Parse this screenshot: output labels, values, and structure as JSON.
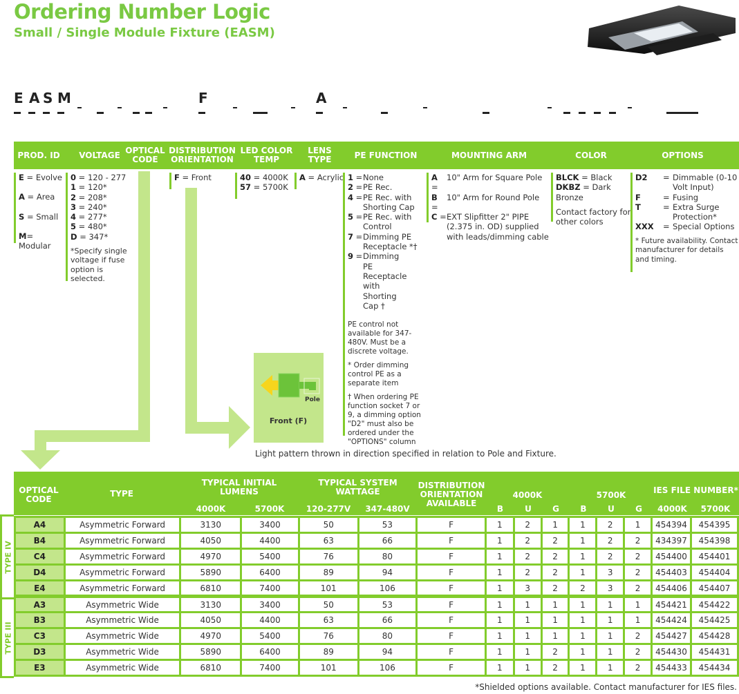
{
  "header": {
    "title": "Ordering Number Logic",
    "subtitle": "Small / Single Module Fixture (EASM)"
  },
  "code_template": {
    "chars": [
      "E",
      "A",
      "S",
      "M",
      "F",
      "A"
    ]
  },
  "columns": {
    "prod_id": {
      "label": "PROD. ID",
      "items": [
        {
          "code": "E",
          "sep": " = ",
          "text": "Evolve"
        },
        {
          "code": "A",
          "sep": " = ",
          "text": "Area"
        },
        {
          "code": "S",
          "sep": " = ",
          "text": "Small"
        },
        {
          "code": "M",
          "sep": "= ",
          "text": "Modular"
        }
      ]
    },
    "voltage": {
      "label": "VOLTAGE",
      "items": [
        {
          "code": "0",
          "text": " = 120 - 277"
        },
        {
          "code": "1",
          "text": " = 120*"
        },
        {
          "code": "2",
          "text": " = 208*"
        },
        {
          "code": "3",
          "text": " = 240*"
        },
        {
          "code": "4",
          "text": " = 277*"
        },
        {
          "code": "5",
          "text": " = 480*"
        },
        {
          "code": "D",
          "text": " = 347*"
        }
      ],
      "note": "*Specify single voltage if fuse option is selected."
    },
    "optical_code": {
      "label": "OPTICAL CODE"
    },
    "distribution": {
      "label": "DISTRIBUTION ORIENTATION",
      "items": [
        {
          "code": "F",
          "text": " = Front"
        }
      ]
    },
    "led_color": {
      "label": "LED COLOR TEMP",
      "items": [
        {
          "code": "40",
          "text": " = 4000K"
        },
        {
          "code": "57",
          "text": " = 5700K"
        }
      ]
    },
    "lens": {
      "label": "LENS TYPE",
      "items": [
        {
          "code": "A",
          "text": " = Acrylic"
        }
      ]
    },
    "pe_function": {
      "label": "PE FUNCTION",
      "items": [
        {
          "code": "1",
          "text": "None"
        },
        {
          "code": "2",
          "text": "PE Rec."
        },
        {
          "code": "4",
          "text": "PE Rec. with Shorting Cap"
        },
        {
          "code": "5",
          "text": "PE Rec. with Control"
        },
        {
          "code": "7",
          "text": "Dimming PE Receptacle *†"
        },
        {
          "code": "9",
          "text": "Dimming PE Receptacle with Shorting Cap †"
        }
      ],
      "notes": [
        "PE control not available for 347-480V. Must be a discrete voltage.",
        "* Order dimming control PE as a separate item",
        "† When ordering PE function socket 7 or 9, a dimming option \"D2\" must also be ordered under the \"OPTIONS\" column"
      ]
    },
    "mounting_arm": {
      "label": "MOUNTING ARM",
      "items": [
        {
          "code": "A",
          "text": "10\" Arm for Square Pole"
        },
        {
          "code": "B",
          "text": "10\" Arm for Round Pole"
        },
        {
          "code": "C",
          "text": "EXT Slipfitter 2\" PIPE (2.375 in. OD) supplied with leads/dimming cable"
        }
      ]
    },
    "color": {
      "label": "COLOR",
      "items": [
        {
          "code": "BLCK",
          "text": " = Black"
        },
        {
          "code": "DKBZ",
          "text": " = Dark Bronze"
        }
      ],
      "note": "Contact factory for other colors"
    },
    "options": {
      "label": "OPTIONS",
      "items": [
        {
          "code": "D2",
          "text": "Dimmable (0-10 Volt Input)"
        },
        {
          "code": "F",
          "text": "Fusing"
        },
        {
          "code": "T",
          "text": "Extra Surge Protection*"
        },
        {
          "code": "XXX",
          "text": "Special Options"
        }
      ],
      "note": "* Future availability. Contact manufacturer for details and timing."
    }
  },
  "diagram": {
    "pole_label": "Pole",
    "front_label": "Front (F)",
    "caption": "Light pattern thrown in direction specified in relation to Pole and Fixture."
  },
  "table": {
    "headers": {
      "optical_code": "OPTICAL CODE",
      "type": "TYPE",
      "lumens": "TYPICAL INITIAL LUMENS",
      "lumens_4000": "4000K",
      "lumens_5700": "5700K",
      "wattage": "TYPICAL SYSTEM WATTAGE",
      "watt_120": "120-277V",
      "watt_347": "347-480V",
      "distribution": "DISTRIBUTION ORIENTATION AVAILABLE",
      "bug_4000": "4000K",
      "bug_5700": "5700K",
      "b": "B",
      "u": "U",
      "g": "G",
      "ies": "IES FILE NUMBER*",
      "ies_4000": "4000K",
      "ies_5700": "5700K"
    },
    "groups": [
      {
        "label": "TYPE IV"
      },
      {
        "label": "TYPE III"
      }
    ],
    "rows": [
      [
        "A4",
        "Asymmetric Forward",
        "3130",
        "3400",
        "50",
        "53",
        "F",
        "1",
        "2",
        "1",
        "1",
        "2",
        "1",
        "454394",
        "454395"
      ],
      [
        "B4",
        "Asymmetric Forward",
        "4050",
        "4400",
        "63",
        "66",
        "F",
        "1",
        "2",
        "2",
        "1",
        "2",
        "2",
        "434397",
        "454398"
      ],
      [
        "C4",
        "Asymmetric Forward",
        "4970",
        "5400",
        "76",
        "80",
        "F",
        "1",
        "2",
        "2",
        "1",
        "2",
        "2",
        "454400",
        "454401"
      ],
      [
        "D4",
        "Asymmetric Forward",
        "5890",
        "6400",
        "89",
        "94",
        "F",
        "1",
        "2",
        "2",
        "1",
        "3",
        "2",
        "454403",
        "454404"
      ],
      [
        "E4",
        "Asymmetric Forward",
        "6810",
        "7400",
        "101",
        "106",
        "F",
        "1",
        "3",
        "2",
        "2",
        "3",
        "2",
        "454406",
        "454407"
      ],
      [
        "A3",
        "Asymmetric Wide",
        "3130",
        "3400",
        "50",
        "53",
        "F",
        "1",
        "1",
        "1",
        "1",
        "1",
        "1",
        "454421",
        "454422"
      ],
      [
        "B3",
        "Asymmetric Wide",
        "4050",
        "4400",
        "63",
        "66",
        "F",
        "1",
        "1",
        "1",
        "1",
        "1",
        "1",
        "454424",
        "454425"
      ],
      [
        "C3",
        "Asymmetric Wide",
        "4970",
        "5400",
        "76",
        "80",
        "F",
        "1",
        "1",
        "1",
        "1",
        "1",
        "2",
        "454427",
        "454428"
      ],
      [
        "D3",
        "Asymmetric Wide",
        "5890",
        "6400",
        "89",
        "94",
        "F",
        "1",
        "1",
        "2",
        "1",
        "1",
        "2",
        "454430",
        "454431"
      ],
      [
        "E3",
        "Asymmetric Wide",
        "6810",
        "7400",
        "101",
        "106",
        "F",
        "1",
        "1",
        "2",
        "1",
        "1",
        "2",
        "454433",
        "454434"
      ]
    ],
    "footnote": "*Shielded options available. Contact manufacturer for IES files."
  },
  "colors": {
    "brand_green": "#82cc2c",
    "light_green": "#c3e68b",
    "title_green": "#7ac943",
    "arrow_yellow": "#f7d51d"
  }
}
